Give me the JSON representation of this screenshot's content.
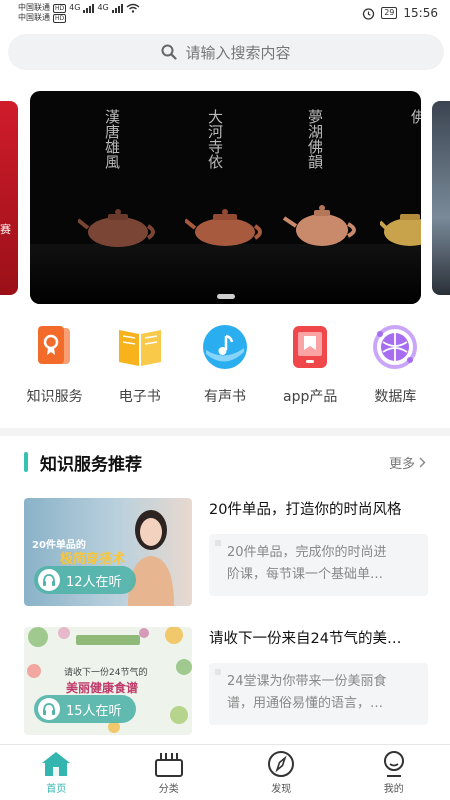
{
  "status_bar": {
    "carrier1": "中国联通",
    "carrier2": "中国联通",
    "hd": "HD",
    "net1": "4G",
    "net2": "4G",
    "battery": "29",
    "time": "15:56"
  },
  "search": {
    "placeholder": "请输入搜索内容"
  },
  "banner": {
    "calligraphy": [
      "漢唐雄風",
      "大河寺依",
      "夢湖佛韻",
      "佛"
    ],
    "left_peek_text": "赛"
  },
  "categories": [
    {
      "label": "知识服务",
      "icon": "knowledge-service-icon",
      "color": "#f36b2b"
    },
    {
      "label": "电子书",
      "icon": "ebook-icon",
      "color": "#f7b21c"
    },
    {
      "label": "有声书",
      "icon": "audiobook-icon",
      "color": "#2aaef0"
    },
    {
      "label": "app产品",
      "icon": "app-product-icon",
      "color": "#f0474a"
    },
    {
      "label": "数据库",
      "icon": "database-icon",
      "color": "#a66df0"
    }
  ],
  "section": {
    "title": "知识服务推荐",
    "more": "更多"
  },
  "recommendations": [
    {
      "thumb_caption": "20件单品的",
      "thumb_highlight": "极简穿搭术",
      "listening": "12人在听",
      "title": "20件单品，打造你的时尚风格",
      "desc_line1": "20件单品，完成你的时尚进",
      "desc_line2": "阶课，每节课一个基础单…"
    },
    {
      "thumb_caption": "请收下一份24节气的",
      "thumb_highlight": "美丽健康食谱",
      "listening": "15人在听",
      "title": "请收下一份来自24节气的美…",
      "desc_line1": "24堂课为你带来一份美丽食",
      "desc_line2": "谱，用通俗易懂的语言，…"
    }
  ],
  "tabs": [
    {
      "label": "首页",
      "icon": "home-icon",
      "active": true
    },
    {
      "label": "分类",
      "icon": "category-icon",
      "active": false
    },
    {
      "label": "发现",
      "icon": "compass-icon",
      "active": false
    },
    {
      "label": "我的",
      "icon": "profile-icon",
      "active": false
    }
  ],
  "colors": {
    "accent": "#35b5b0",
    "section_bar": "#35c2b3"
  }
}
